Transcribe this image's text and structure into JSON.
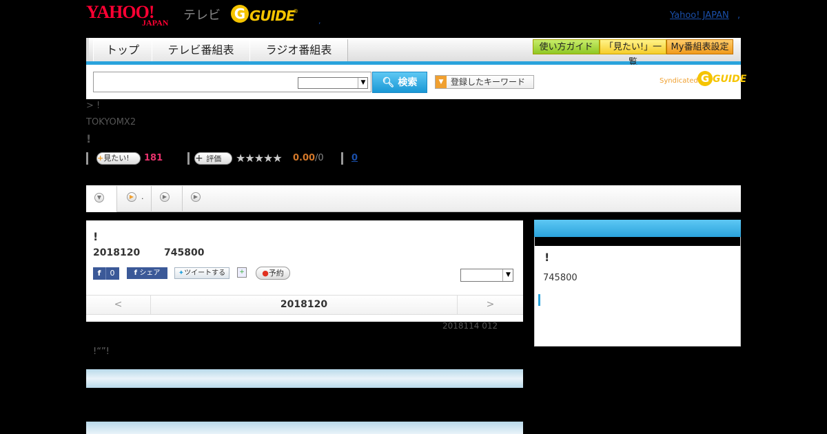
{
  "header": {
    "logo_yahoo": "YAHOO!",
    "logo_japan": "JAPAN",
    "logo_tv": "テレビ",
    "logo_g": "G",
    "logo_guide": "GUIDE",
    "logo_reg": "®",
    "dot": ",",
    "yahoo_japan_link": "Yahoo! JAPAN",
    "trailing_dot": ","
  },
  "nav": {
    "tabs": [
      "トップ",
      "テレビ番組表",
      "ラジオ番組表"
    ],
    "right_buttons": [
      "使い方ガイド",
      "「見たい!」一覧",
      "My番組表設定"
    ]
  },
  "search": {
    "input_value": "",
    "select_value": "",
    "button_label": "検索",
    "keyword_button_label": "登録したキーワード",
    "syndicated": "Syndicated",
    "syn_g": "G",
    "syn_guide": "GUIDE"
  },
  "program": {
    "breadcrumb": "> !",
    "channel": "TOKYOMX2",
    "title": "!",
    "watch_label": "見たい!",
    "watch_count": "181",
    "rate_label": "評価",
    "stars": "★★★★★",
    "rating": "0.00",
    "rating_count": "/0",
    "comment_count": "0"
  },
  "content_tabs": [
    {
      "label": ""
    },
    {
      "label": "."
    },
    {
      "label": ""
    },
    {
      "label": ""
    }
  ],
  "detail": {
    "title": "!",
    "date": "2018120",
    "time": "745800",
    "fb_like_count": "0",
    "fb_share": "シェア",
    "tweet": "ツイートする",
    "reserve": "予約",
    "select_value": "",
    "pager_prev": "<",
    "pager_date": "2018120",
    "pager_next": ">",
    "updated": "2018114  012",
    "description": "!“”!"
  },
  "side": {
    "title": "!",
    "time": "745800"
  },
  "colors": {
    "accent_blue": "#2aa3dc",
    "brand_red": "#ff0033",
    "guide_yellow": "#f5c400",
    "link_blue": "#1a4faa",
    "watch_pink": "#e8336d",
    "rating_orange": "#d4782a"
  }
}
